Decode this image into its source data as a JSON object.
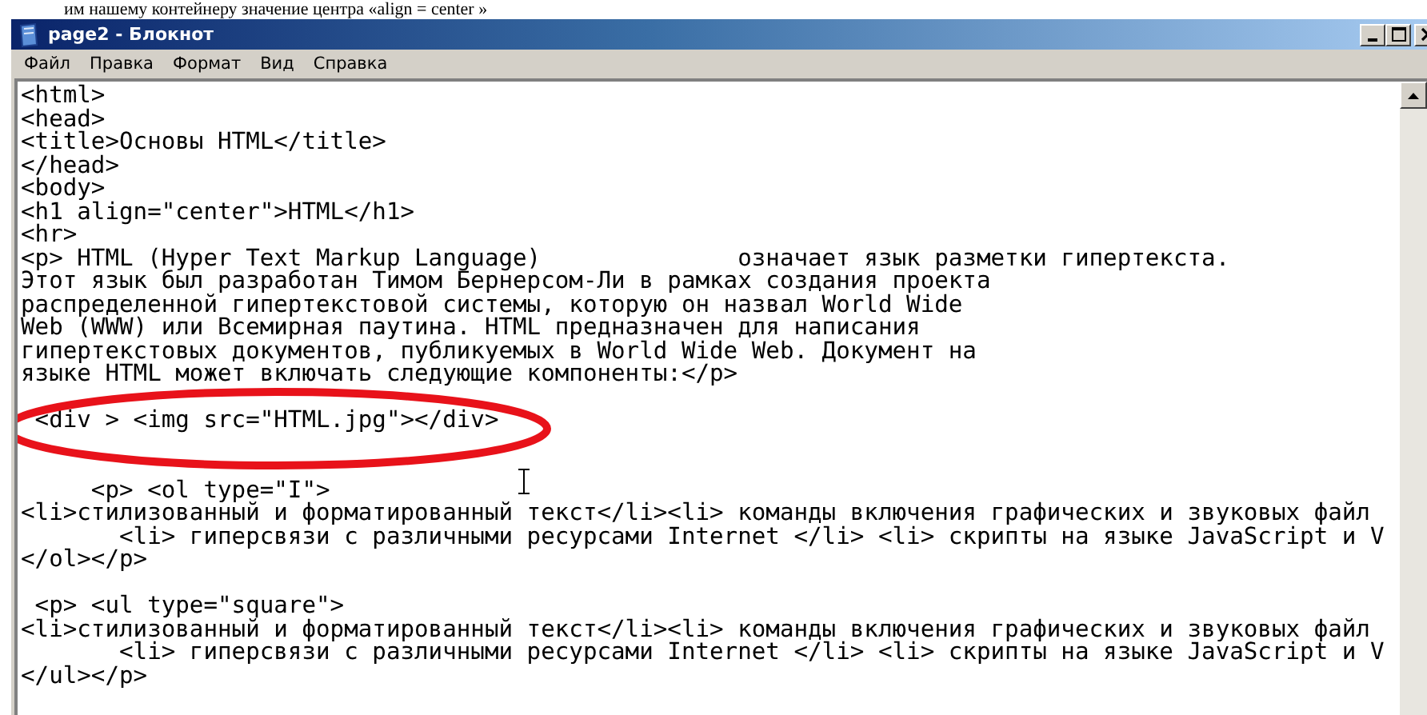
{
  "caption_text": "им нашему контейнеру значение центра «align = center »",
  "window": {
    "title": "page2 - Блокнот"
  },
  "menu": [
    {
      "label": "Файл"
    },
    {
      "label": "Правка"
    },
    {
      "label": "Формат"
    },
    {
      "label": "Вид"
    },
    {
      "label": "Справка"
    }
  ],
  "editor": {
    "lines": [
      {
        "kind": "text",
        "text": "<html>"
      },
      {
        "kind": "text",
        "text": "<head>"
      },
      {
        "kind": "text",
        "text": "<title>Основы HTML</title>"
      },
      {
        "kind": "text",
        "text": "</head>"
      },
      {
        "kind": "text",
        "text": "<body>"
      },
      {
        "kind": "text",
        "text": "<h1 align=\"center\">HTML</h1>"
      },
      {
        "kind": "text",
        "text": "<hr>"
      },
      {
        "kind": "text",
        "text": "<p> HTML (Hyper Text Markup Language)              означает язык разметки гипертекста."
      },
      {
        "kind": "text",
        "text": "Этот язык был разработан Тимом Бернерсом-Ли в рамках создания проекта"
      },
      {
        "kind": "text",
        "text": "распределенной гипертекстовой системы, которую он назвал World Wide"
      },
      {
        "kind": "text",
        "text": "Web (WWW) или Всемирная паутина. HTML предназначен для написания"
      },
      {
        "kind": "text",
        "text": "гипертекстовых документов, публикуемых в World Wide Web. Документ на"
      },
      {
        "kind": "text",
        "text": "языке HTML может включать следующие компоненты:</p>"
      },
      {
        "kind": "blank"
      },
      {
        "kind": "text",
        "text": " <div > <img src=\"HTML.jpg\"></div>"
      },
      {
        "kind": "blank"
      },
      {
        "kind": "blank"
      },
      {
        "kind": "text",
        "text": "     <p> <ol type=\"I\">"
      },
      {
        "kind": "text",
        "text": "<li>стилизованный и форматированный текст</li><li> команды включения графических и звуковых файл"
      },
      {
        "kind": "text",
        "text": "       <li> гиперсвязи с различными ресурсами Internet </li> <li> скрипты на языке JavaScript и V"
      },
      {
        "kind": "text",
        "text": "</ol></p>"
      },
      {
        "kind": "blank"
      },
      {
        "kind": "text",
        "text": " <p> <ul type=\"square\">"
      },
      {
        "kind": "text",
        "text": "<li>стилизованный и форматированный текст</li><li> команды включения графических и звуковых файл"
      },
      {
        "kind": "text",
        "text": "       <li> гиперсвязи с различными ресурсами Internet </li> <li> скрипты на языке JavaScript и V"
      },
      {
        "kind": "text",
        "text": "</ul></p>"
      }
    ]
  }
}
